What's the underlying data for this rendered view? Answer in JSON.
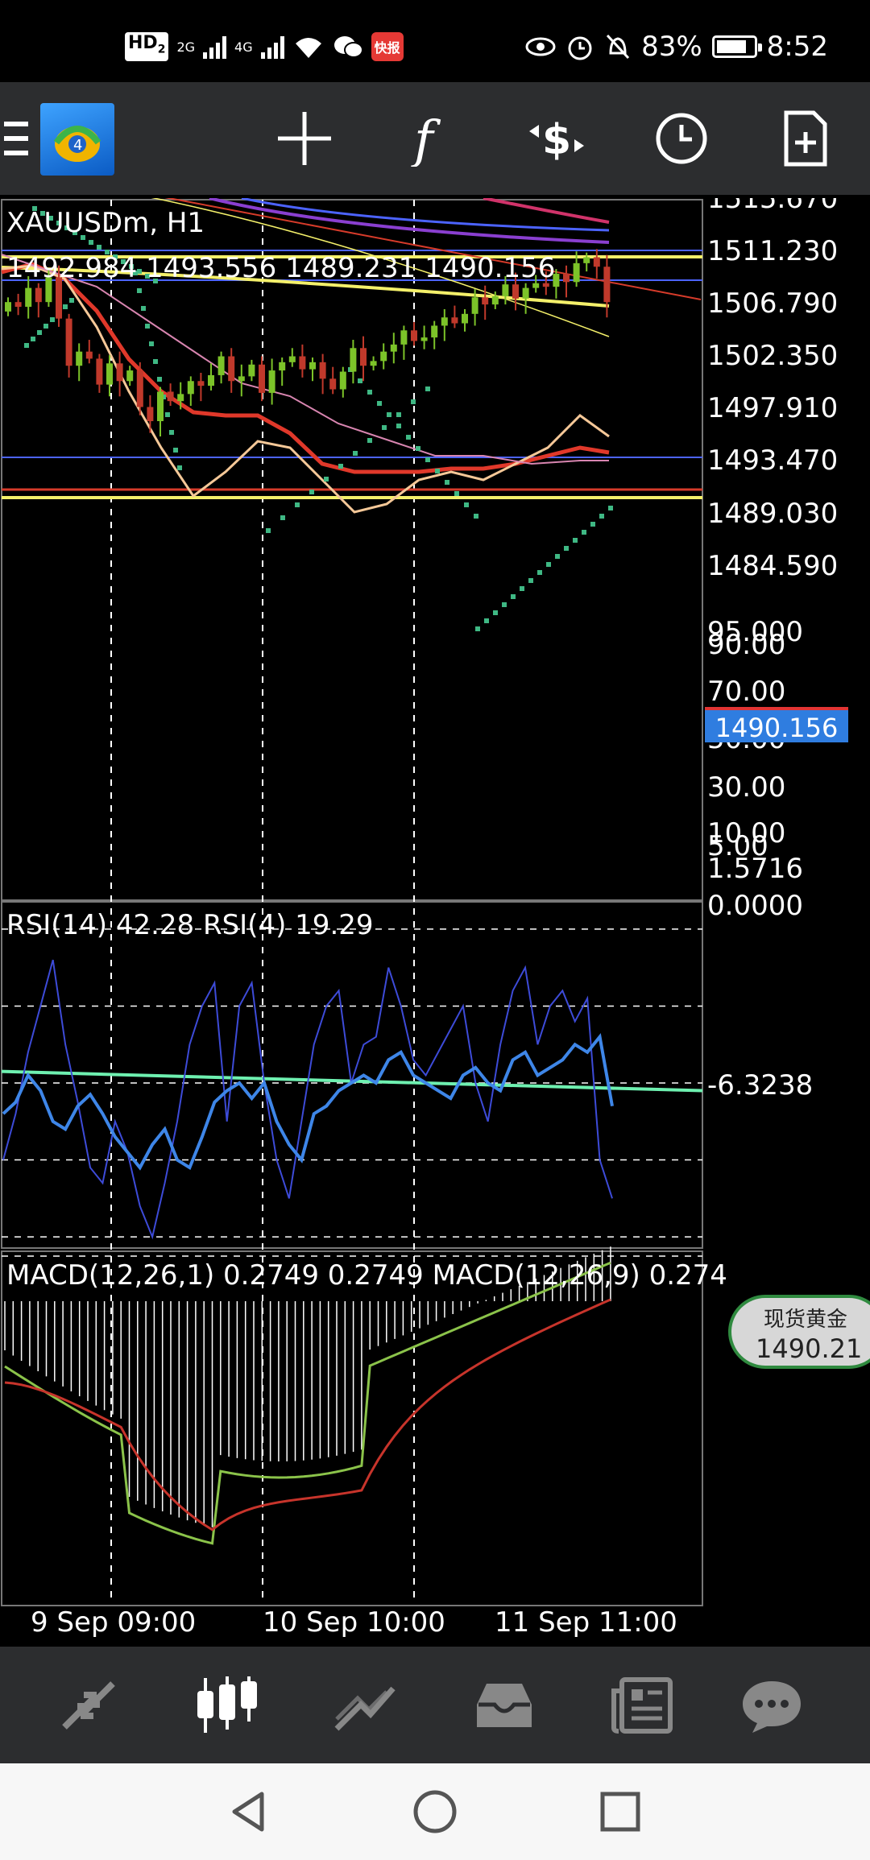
{
  "status_bar": {
    "hd_label": "HD",
    "hd_sub": "2",
    "sig1": "2G",
    "sig2": "4G",
    "app_badge": "快报",
    "battery_percent": "83%",
    "time": "8:52",
    "battery_level": 0.83
  },
  "toolbar": {
    "menu_icon": "hamburger-icon",
    "logo_icon": "mt4-logo-icon",
    "crosshair_icon": "crosshair-icon",
    "indicator_icon": "function-icon",
    "trade_icon": "dollar-trade-icon",
    "period_icon": "clock-icon",
    "template_icon": "new-document-icon"
  },
  "chart": {
    "symbol_title": "XAUUSDm, H1",
    "ohlc": "1492.984 1493.556 1489.231 1490.156",
    "current_price": "1490.156",
    "price_axis": [
      "1515.670",
      "1511.230",
      "1506.790",
      "1502.350",
      "1497.910",
      "1493.470",
      "1489.030",
      "1484.590"
    ],
    "rsi_label": "RSI(14) 42.28 RSI(4) 19.29",
    "rsi_axis": [
      "95.000",
      "90.00",
      "70.00",
      "50.00",
      "30.00",
      "10.00",
      "5.00"
    ],
    "macd_label": "MACD(12,26,1) 0.2749 0.2749 MACD(12,26,9) 0.274",
    "macd_axis": [
      "1.5716",
      "0.0000",
      "-6.3238"
    ],
    "time_axis": [
      "9 Sep 09:00",
      "10 Sep 10:00",
      "11 Sep 11:00"
    ],
    "colors": {
      "bull": "#7cc329",
      "bear": "#c0392b",
      "grid": "#ffffff",
      "yellow": "#f4f06a",
      "blue_line": "#4c63ff",
      "red_line": "#d63b2a",
      "purple": "#8a3fd0",
      "psar": "#3fb884",
      "rsi14": "#3e86e8",
      "rsi4": "#3d4bd8",
      "rsi_trend": "#6ef0b0",
      "macd_signal": "#c7342b",
      "macd_main": "#8bc34a"
    }
  },
  "gold_widget": {
    "title": "现货黄金",
    "price": "1490.21"
  },
  "bottom_nav": {
    "items": [
      {
        "icon": "quotes-arrows-icon",
        "active": false
      },
      {
        "icon": "candlestick-chart-icon",
        "active": true
      },
      {
        "icon": "trade-chart-icon",
        "active": false
      },
      {
        "icon": "history-inbox-icon",
        "active": false
      },
      {
        "icon": "news-icon",
        "active": false
      },
      {
        "icon": "chat-icon",
        "active": false
      }
    ]
  },
  "system_nav": {
    "back_icon": "back-triangle-icon",
    "home_icon": "home-circle-icon",
    "recents_icon": "recents-square-icon"
  }
}
